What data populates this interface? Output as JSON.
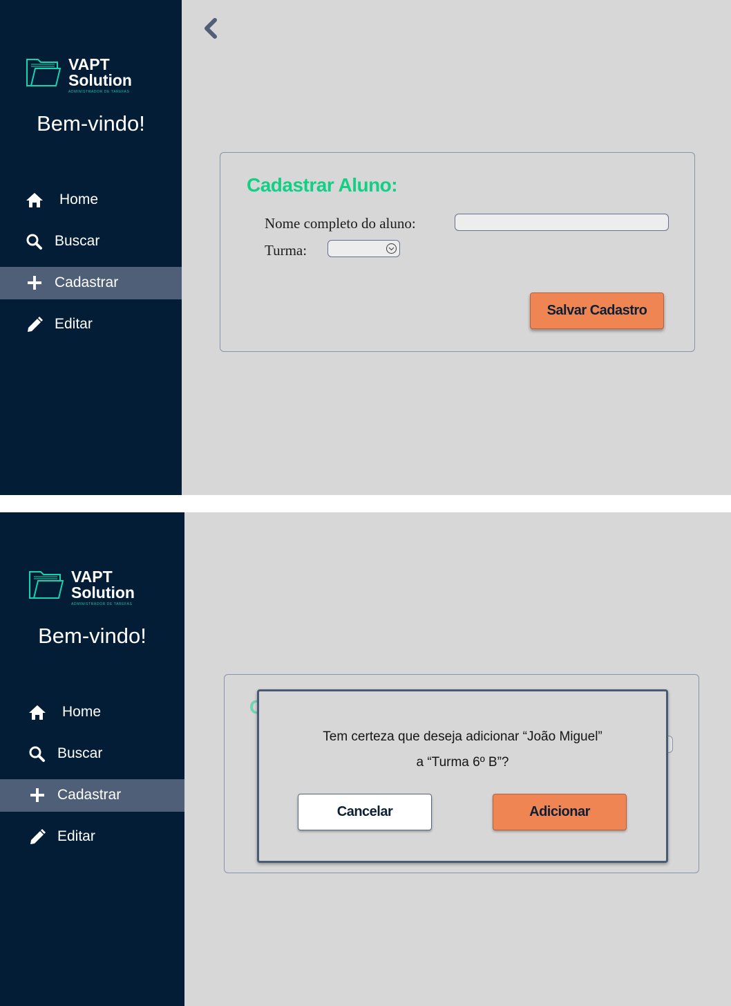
{
  "brand": {
    "line1": "VAPT",
    "line2": "Solution",
    "tagline": "ADMINISTRADOR DE TAREFAS",
    "logo_icon": "folder-icon"
  },
  "sidebar": {
    "welcome": "Bem-vindo!",
    "items": [
      {
        "label": "Home",
        "icon": "home-icon"
      },
      {
        "label": "Buscar",
        "icon": "search-icon"
      },
      {
        "label": "Cadastrar",
        "icon": "plus-icon",
        "active": true
      },
      {
        "label": "Editar",
        "icon": "pencil-icon"
      }
    ]
  },
  "form": {
    "title": "Cadastrar Aluno:",
    "name_label": "Nome completo do aluno:",
    "name_value": "",
    "class_label": "Turma:",
    "class_value": "",
    "save_label": "Salvar Cadastro"
  },
  "dialog": {
    "message_line1": "Tem certeza que deseja adicionar “João Miguel”",
    "message_line2": "a  “Turma 6º B”?",
    "cancel_label": "Cancelar",
    "confirm_label": "Adicionar"
  },
  "colors": {
    "sidebar_bg": "#031d37",
    "active_item": "#4f5f78",
    "content_bg": "#d7d7d7",
    "accent_green": "#12d083",
    "primary_button": "#f08554"
  }
}
